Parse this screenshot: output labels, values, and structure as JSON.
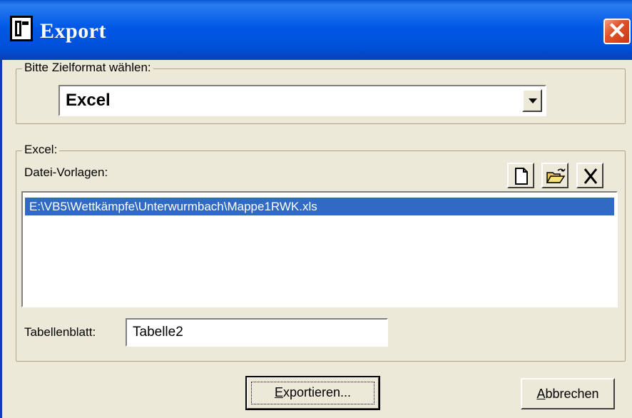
{
  "window": {
    "title": "Export",
    "close_label": "✕"
  },
  "format_group": {
    "label": "Bitte Zielformat wählen:",
    "selected": "Excel"
  },
  "excel_group": {
    "label": "Excel:",
    "templates_label": "Datei-Vorlagen:",
    "templates": [
      "E:\\VB5\\Wettkämpfe\\Unterwurmbach\\Mappe1RWK.xls"
    ],
    "toolbar": {
      "new_icon": "new-document-icon",
      "open_icon": "open-folder-icon",
      "delete_icon": "delete-x-icon"
    },
    "sheet_label": "Tabellenblatt:",
    "sheet_value": "Tabelle2"
  },
  "buttons": {
    "export_accel": "E",
    "export_rest": "xportieren...",
    "cancel_accel": "A",
    "cancel_rest": "bbrechen"
  },
  "colors": {
    "titlebar": "#0058e6",
    "selection": "#316ac5",
    "dialog_bg": "#ece9d8"
  }
}
